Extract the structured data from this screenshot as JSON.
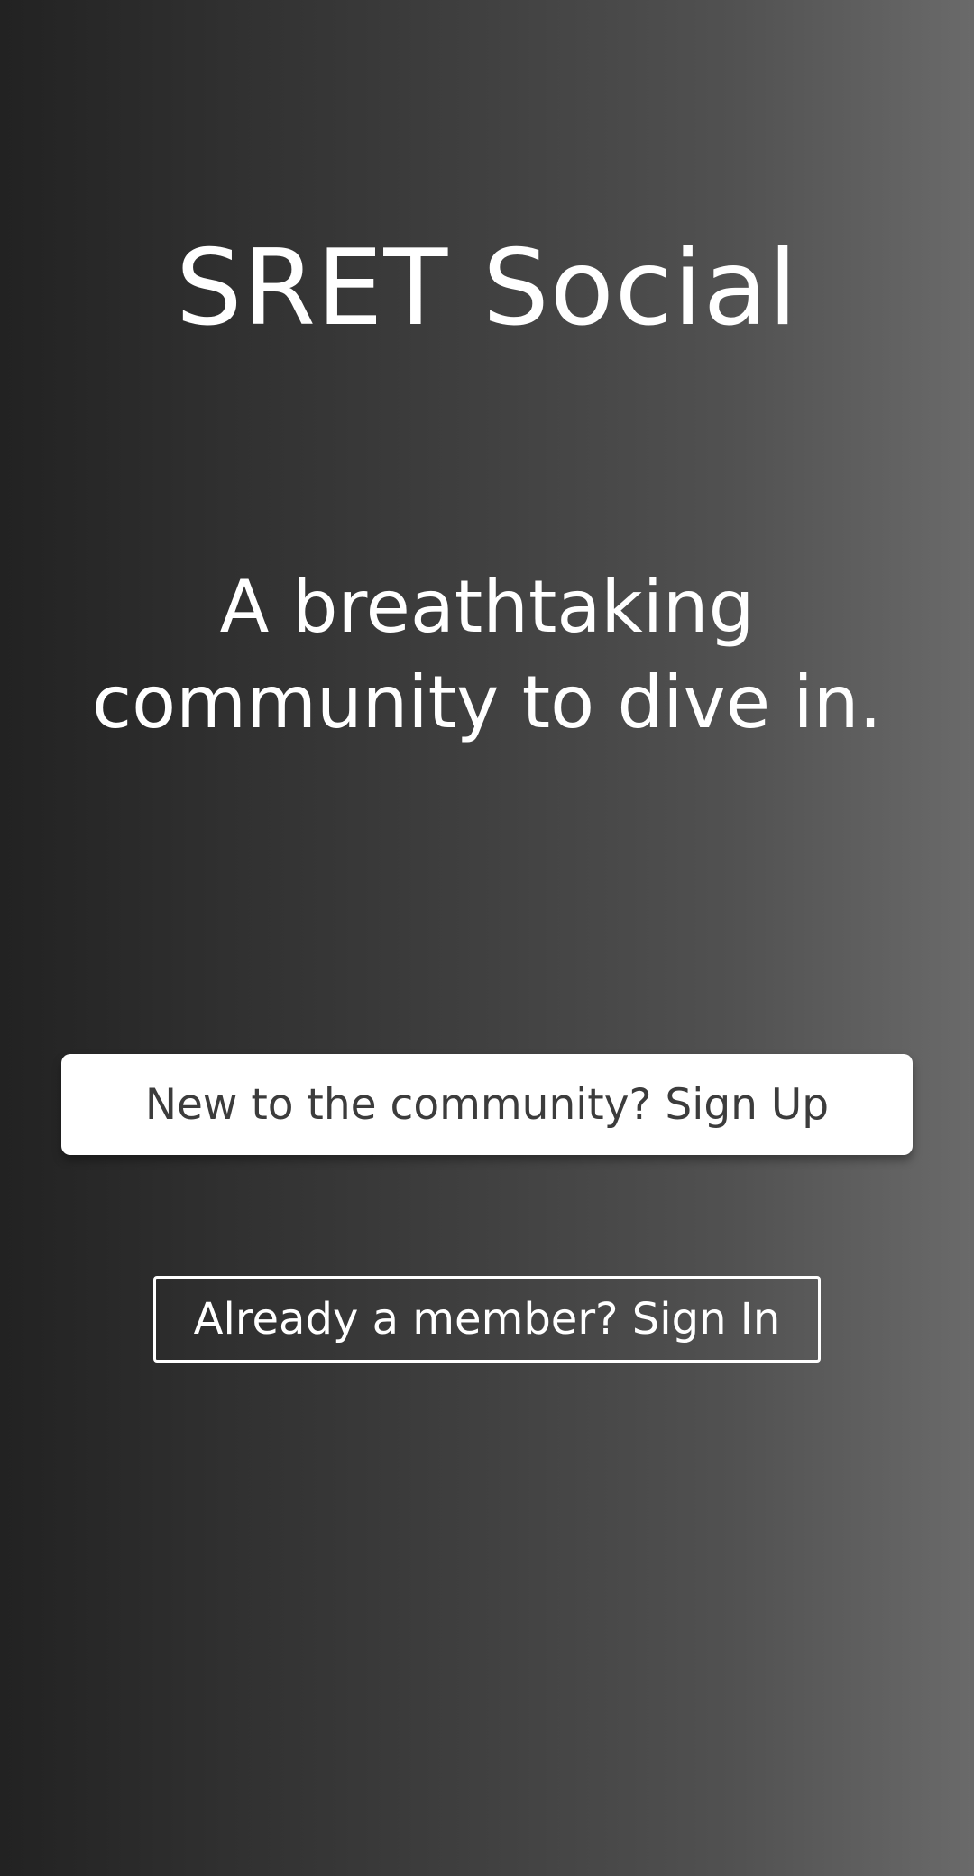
{
  "app": {
    "title": "SRET Social"
  },
  "hero": {
    "tagline": "A breathtaking community to dive in."
  },
  "actions": {
    "signup_label": "New to the community? Sign Up",
    "signin_label": "Already a member? Sign In"
  },
  "colors": {
    "background_dark": "#222222",
    "background_light": "#6a6a6a",
    "text_primary": "#ffffff",
    "signup_button_bg": "#ffffff",
    "signup_button_text": "#3c3c3c"
  }
}
